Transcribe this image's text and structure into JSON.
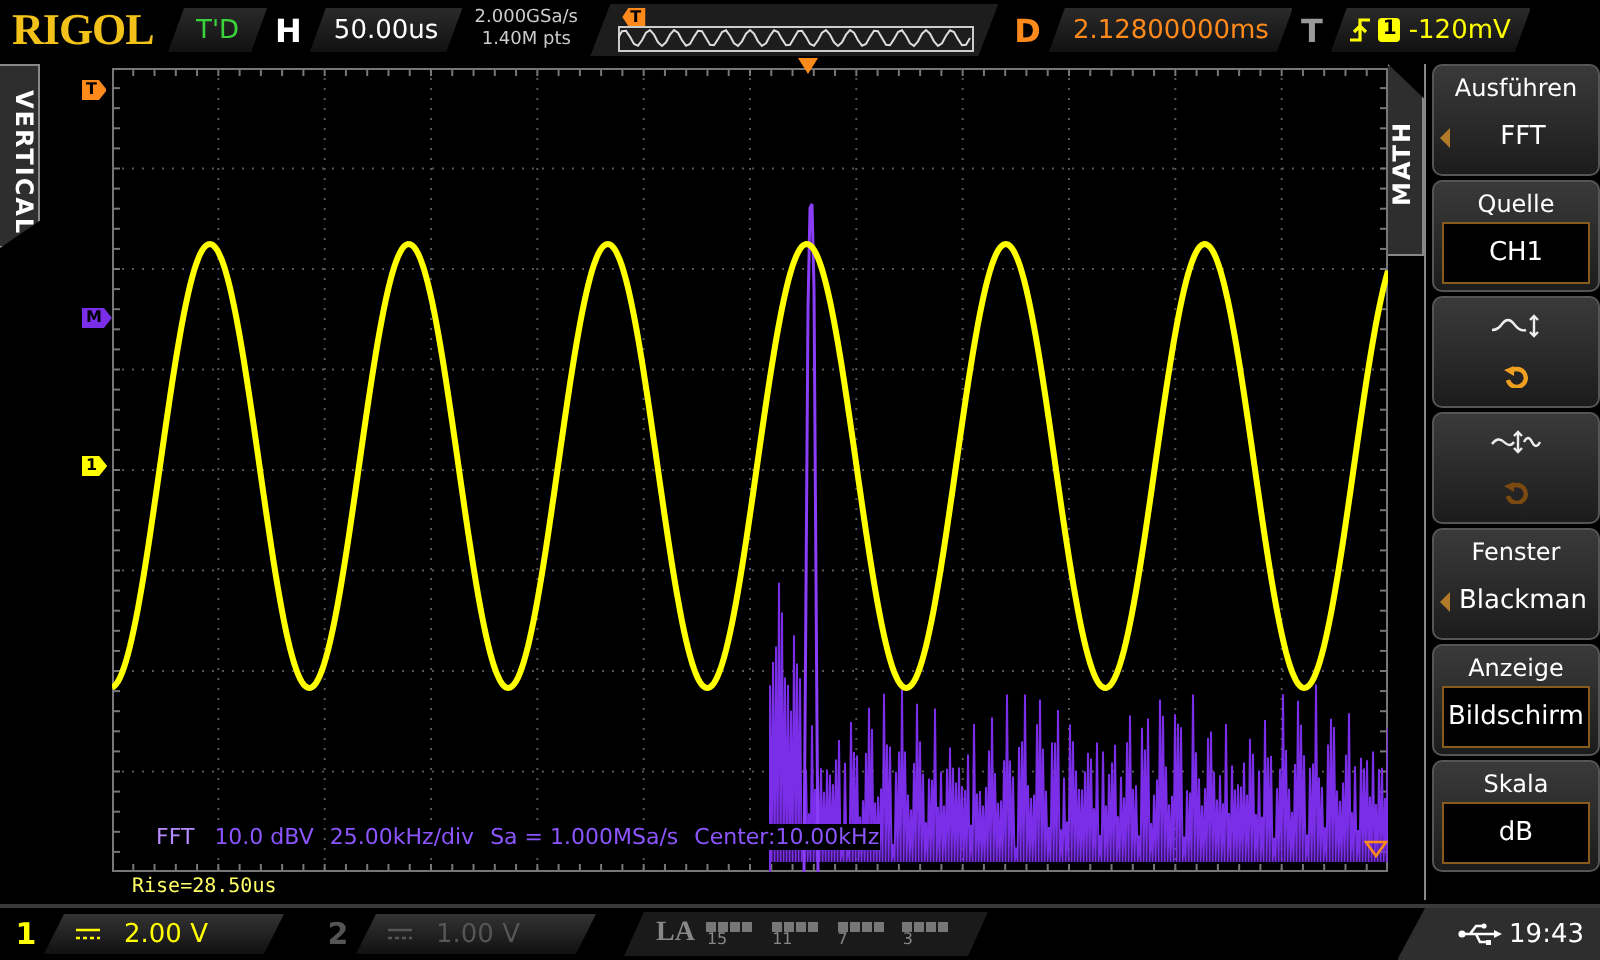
{
  "header": {
    "logo": "RIGOL",
    "run_status": "T'D",
    "horizontal_label": "H",
    "timebase": "50.00us",
    "sample_rate": "2.000GSa/s",
    "memory_depth": "1.40M pts",
    "memory_trigger_marker": "T",
    "delay_label": "D",
    "delay": "2.12800000ms",
    "trigger_label": "T",
    "trigger_source": "1",
    "trigger_level": "-120mV"
  },
  "side_tab": {
    "label": "VERTICAL"
  },
  "screen": {
    "markers": [
      {
        "kind": "trigger",
        "label": "T",
        "color": "#ff8a1c"
      },
      {
        "kind": "math",
        "label": "M",
        "color": "#7a2ee8"
      },
      {
        "kind": "channel",
        "label": "1",
        "color": "#ffff00"
      }
    ],
    "fft_info": {
      "badge": "FFT",
      "scale": "10.0 dBV",
      "span": "25.00kHz/div",
      "sample_rate": "Sa = 1.000MSa/s",
      "center": "Center:10.00kHz"
    },
    "measurement": "Rise=28.50us"
  },
  "menu": {
    "title": "MATH",
    "items": [
      {
        "kind": "select",
        "label": "Ausführen",
        "value": "FFT"
      },
      {
        "kind": "box",
        "label": "Quelle",
        "value": "CH1"
      },
      {
        "kind": "offset",
        "disabled": false
      },
      {
        "kind": "scale",
        "disabled": true
      },
      {
        "kind": "select",
        "label": "Fenster",
        "value": "Blackman"
      },
      {
        "kind": "box",
        "label": "Anzeige",
        "value": "Bildschirm"
      },
      {
        "kind": "box",
        "label": "Skala",
        "value": "dB"
      }
    ]
  },
  "footer": {
    "channels": [
      {
        "number": "1",
        "scale": "2.00 V",
        "enabled": true
      },
      {
        "number": "2",
        "scale": "1.00 V",
        "enabled": false
      }
    ],
    "la": {
      "label": "LA",
      "groups": [
        "15",
        "11",
        "7",
        "3"
      ]
    },
    "time": "19:43"
  }
}
